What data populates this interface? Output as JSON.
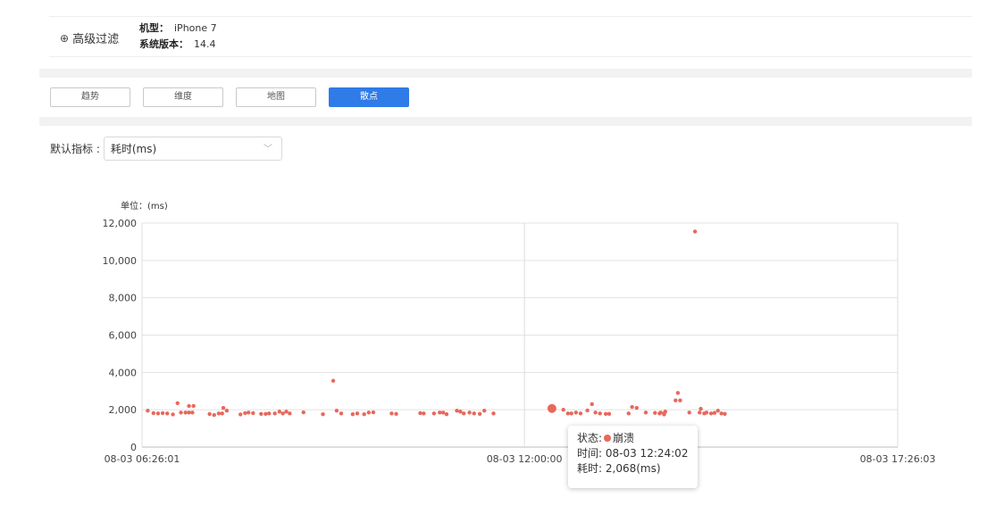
{
  "filter": {
    "advanced_label": "高级过滤",
    "items": [
      {
        "key": "机型：",
        "value": "iPhone 7"
      },
      {
        "key": "系统版本：",
        "value": "14.4"
      }
    ]
  },
  "tabs": [
    {
      "label": "趋势",
      "active": false
    },
    {
      "label": "维度",
      "active": false
    },
    {
      "label": "地图",
      "active": false
    },
    {
      "label": "散点",
      "active": true
    }
  ],
  "metric": {
    "label": "默认指标 :",
    "value": "耗时(ms)"
  },
  "colors": {
    "accent": "#2f7be8",
    "point": "#e8685c"
  },
  "tooltip": {
    "status_label": "状态:",
    "status_value": "崩溃",
    "time_label": "时间:",
    "time_value": "08-03 12:24:02",
    "cost_label": "耗时:",
    "cost_value": "2,068(ms)"
  },
  "chart_data": {
    "type": "scatter",
    "unit_label": "单位：(ms)",
    "ylim": [
      0,
      12000
    ],
    "yticks": [
      "0",
      "2,000",
      "4,000",
      "6,000",
      "8,000",
      "10,000",
      "12,000"
    ],
    "xticks": [
      "08-03 06:26:01",
      "08-03 12:00:00",
      "08-03 17:26:03"
    ],
    "x_range_minutes": [
      0,
      660
    ],
    "grid": true,
    "highlight": {
      "x_minutes": 358,
      "y": 2068
    },
    "points": [
      [
        5,
        1950
      ],
      [
        10,
        1820
      ],
      [
        14,
        1800
      ],
      [
        18,
        1820
      ],
      [
        22,
        1800
      ],
      [
        27,
        1750
      ],
      [
        31,
        2350
      ],
      [
        34,
        1850
      ],
      [
        38,
        1850
      ],
      [
        41,
        1850
      ],
      [
        41,
        2200
      ],
      [
        44,
        1850
      ],
      [
        45,
        2200
      ],
      [
        59,
        1770
      ],
      [
        63,
        1720
      ],
      [
        67,
        1800
      ],
      [
        70,
        1800
      ],
      [
        71,
        2100
      ],
      [
        74,
        1950
      ],
      [
        86,
        1750
      ],
      [
        90,
        1820
      ],
      [
        93,
        1850
      ],
      [
        97,
        1820
      ],
      [
        104,
        1780
      ],
      [
        108,
        1780
      ],
      [
        111,
        1800
      ],
      [
        116,
        1800
      ],
      [
        120,
        1900
      ],
      [
        123,
        1800
      ],
      [
        126,
        1900
      ],
      [
        129,
        1800
      ],
      [
        141,
        1860
      ],
      [
        158,
        1760
      ],
      [
        167,
        3550
      ],
      [
        170,
        1950
      ],
      [
        174,
        1800
      ],
      [
        184,
        1760
      ],
      [
        188,
        1800
      ],
      [
        194,
        1760
      ],
      [
        198,
        1850
      ],
      [
        202,
        1860
      ],
      [
        218,
        1800
      ],
      [
        222,
        1780
      ],
      [
        243,
        1820
      ],
      [
        246,
        1800
      ],
      [
        255,
        1800
      ],
      [
        266,
        1760
      ],
      [
        278,
        1900
      ],
      [
        281,
        1800
      ],
      [
        286,
        1850
      ],
      [
        290,
        1800
      ],
      [
        295,
        1780
      ],
      [
        299,
        1950
      ],
      [
        307,
        1800
      ],
      [
        260,
        1850
      ],
      [
        263,
        1850
      ],
      [
        275,
        1950
      ],
      [
        368,
        2000
      ],
      [
        372,
        1800
      ],
      [
        375,
        1800
      ],
      [
        379,
        1850
      ],
      [
        383,
        1800
      ],
      [
        389,
        1960
      ],
      [
        393,
        2300
      ],
      [
        396,
        1850
      ],
      [
        400,
        1800
      ],
      [
        405,
        1780
      ],
      [
        408,
        1780
      ],
      [
        425,
        1800
      ],
      [
        428,
        2150
      ],
      [
        432,
        2100
      ],
      [
        448,
        1830
      ],
      [
        452,
        1800
      ],
      [
        456,
        1750
      ],
      [
        457,
        1900
      ],
      [
        466,
        2500
      ],
      [
        468,
        2900
      ],
      [
        470,
        2500
      ],
      [
        478,
        1850
      ],
      [
        483,
        11550
      ],
      [
        487,
        1850
      ],
      [
        488,
        2050
      ],
      [
        491,
        1800
      ],
      [
        493,
        1850
      ],
      [
        497,
        1800
      ],
      [
        500,
        1830
      ],
      [
        503,
        1950
      ],
      [
        506,
        1800
      ],
      [
        509,
        1780
      ],
      [
        456,
        1800
      ],
      [
        453,
        1850
      ],
      [
        440,
        1850
      ]
    ]
  }
}
